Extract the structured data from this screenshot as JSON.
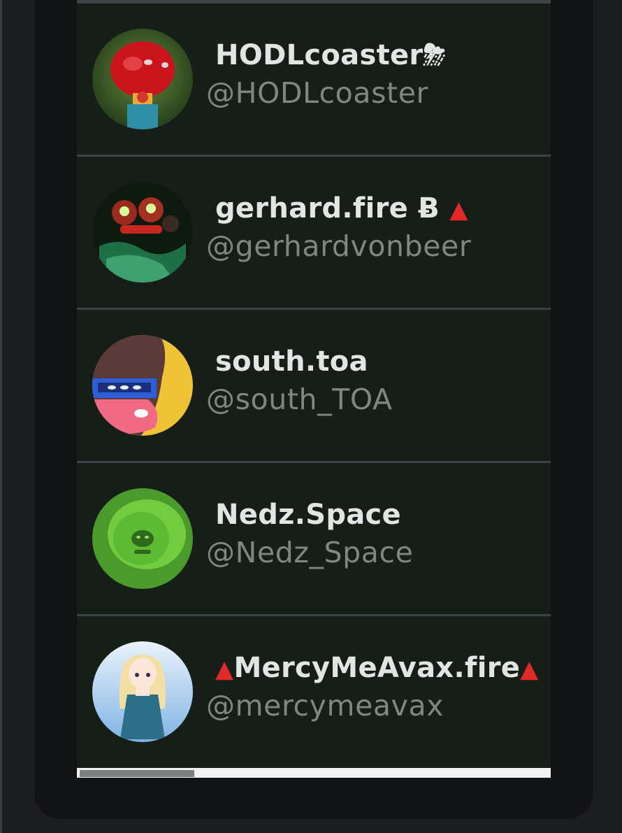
{
  "accounts": [
    {
      "name": "HODLcoaster",
      "suffix": "⛈",
      "handle": "@HODLcoaster",
      "avatar_icon": "red-creature-avatar-icon"
    },
    {
      "name": "gerhard.fire Ƀ",
      "suffix": "▲",
      "handle": "@gerhardvonbeer",
      "avatar_icon": "red-eyed-creature-avatar-icon"
    },
    {
      "name": "south.toa",
      "suffix": "",
      "handle": "@south_TOA",
      "avatar_icon": "pink-masked-creature-avatar-icon"
    },
    {
      "name": "Nedz.Space",
      "suffix": "",
      "handle": "@Nedz_Space",
      "avatar_icon": "green-blob-avatar-icon"
    },
    {
      "prefix": "▲",
      "name": "MercyMeAvax.fire",
      "suffix": "▲",
      "handle": "@mercymeavax",
      "avatar_icon": "anime-girl-avatar-icon"
    }
  ],
  "colors": {
    "row_bg": "#171d17",
    "name_text": "#e3e5e4",
    "handle_text": "#7f8785",
    "accent_red": "#e02a2a"
  },
  "scrollbar": {
    "position_fraction": 0.24
  }
}
